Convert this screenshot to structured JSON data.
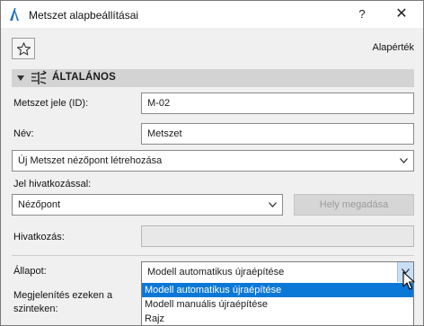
{
  "window": {
    "title": "Metszet alapbeállításai",
    "help_label": "?",
    "close_label": "✕"
  },
  "toolbar": {
    "defaults_label": "Alapérték"
  },
  "panel": {
    "title": "ÁLTALÁNOS"
  },
  "fields": {
    "id_label": "Metszet jele (ID):",
    "id_value": "M-02",
    "name_label": "Név:",
    "name_value": "Metszet",
    "viewpoint_select": "Új Metszet nézőpont létrehozása",
    "ref_label": "Jel hivatkozással:",
    "ref_select": "Nézőpont",
    "locate_button": "Hely megadása",
    "reference_label": "Hivatkozás:",
    "reference_value": "",
    "status_label": "Állapot:",
    "status_select": "Modell automatikus újraépítése",
    "show_on_label_1": "Megjelenítés ezeken a",
    "show_on_label_2": "szinteken:"
  },
  "status_options": [
    "Modell automatikus újraépítése",
    "Modell manuális újraépítése",
    "Rajz"
  ],
  "colors": {
    "selection": "#0b78d7",
    "panel_header": "#d3d3d3"
  }
}
